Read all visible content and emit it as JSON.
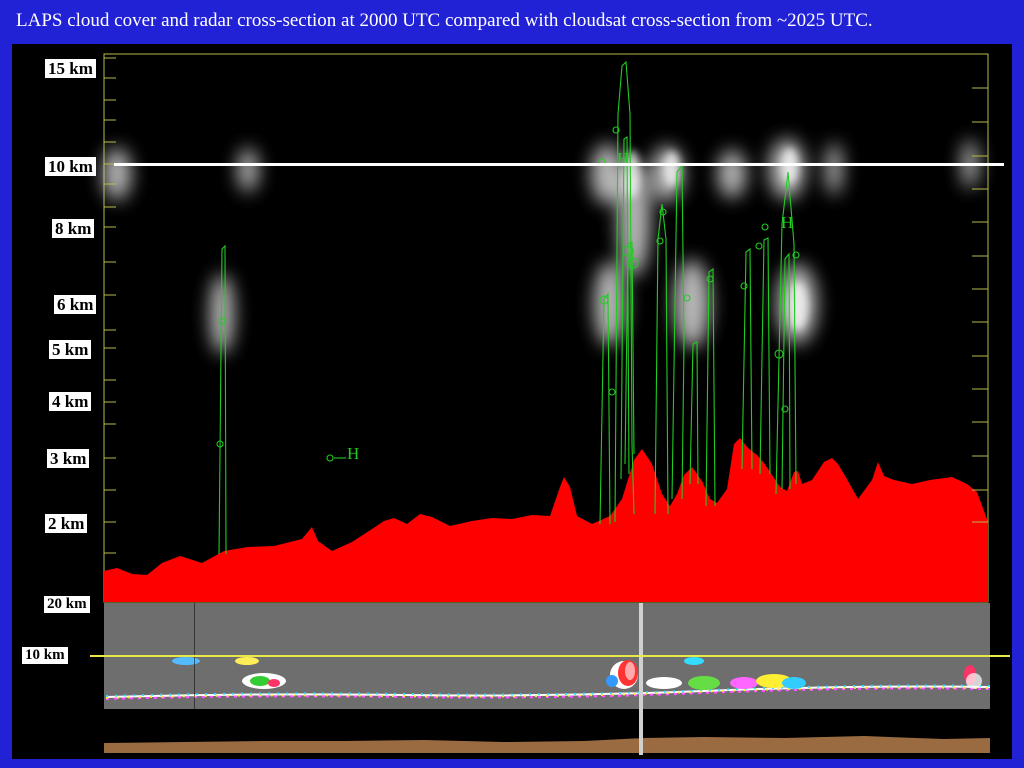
{
  "slide": {
    "title": "LAPS cloud cover and radar cross-section at 2000 UTC compared with cloudsat cross-section from ~2025 UTC."
  },
  "laps_panel": {
    "height_labels": [
      "15 km",
      "10 km",
      "8 km",
      "6 km",
      "5 km",
      "4 km",
      "3 km",
      "2 km"
    ],
    "contour_labels": [
      "H",
      "H",
      "H"
    ]
  },
  "cloudsat_panel": {
    "height_labels": [
      "20 km",
      "10 km"
    ]
  },
  "colors": {
    "background": "#2121d6",
    "radar_echo": "#ff0000",
    "cloud_contours": "#22cc22",
    "reference_line_top": "#ffffff",
    "reference_line_bottom": "#e8e84a",
    "ground_track": "#9a6a40"
  }
}
